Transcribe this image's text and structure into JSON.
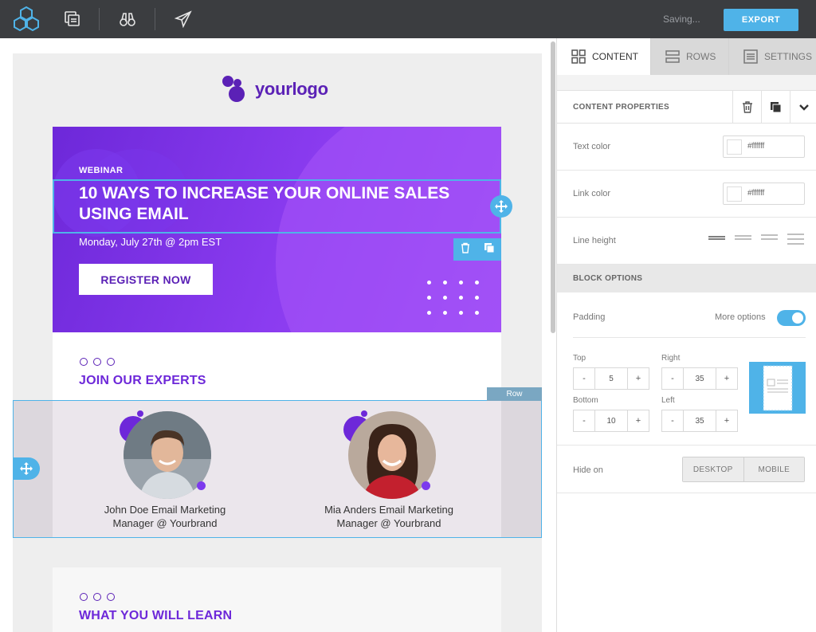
{
  "topbar": {
    "saving_status": "Saving...",
    "export_label": "EXPORT"
  },
  "email": {
    "logo_text": "yourlogo",
    "hero": {
      "eyebrow": "WEBINAR",
      "headline": "10 WAYS TO INCREASE YOUR ONLINE SALES USING EMAIL",
      "date": "Monday, July 27th @ 2pm EST",
      "cta_label": "REGISTER NOW"
    },
    "experts_title": "JOIN OUR EXPERTS",
    "row_tag": "Row",
    "people": [
      {
        "name_line1": "John Doe Email Marketing",
        "name_line2": "Manager @ Yourbrand"
      },
      {
        "name_line1": "Mia Anders Email Marketing",
        "name_line2": "Manager @ Yourbrand"
      }
    ],
    "learn_title": "WHAT YOU WILL LEARN"
  },
  "panel": {
    "tabs": [
      {
        "label": "CONTENT",
        "icon": "grid-icon",
        "active": true
      },
      {
        "label": "ROWS",
        "icon": "rows-icon",
        "active": false
      },
      {
        "label": "SETTINGS",
        "icon": "settings-list-icon",
        "active": false
      }
    ],
    "content_properties_title": "CONTENT PROPERTIES",
    "text_color": {
      "label": "Text color",
      "value": "#ffffff"
    },
    "link_color": {
      "label": "Link color",
      "value": "#ffffff"
    },
    "line_height_label": "Line height",
    "block_options_title": "BLOCK OPTIONS",
    "padding_label": "Padding",
    "more_options_label": "More options",
    "more_options_enabled": true,
    "padding": {
      "top": {
        "label": "Top",
        "value": "5"
      },
      "right": {
        "label": "Right",
        "value": "35"
      },
      "bottom": {
        "label": "Bottom",
        "value": "10"
      },
      "left": {
        "label": "Left",
        "value": "35"
      }
    },
    "hide_on_label": "Hide on",
    "hide_on_options": [
      "DESKTOP",
      "MOBILE"
    ]
  },
  "colors": {
    "accent": "#4fb3e8",
    "brand_purple": "#6d28d9",
    "topbar": "#3b3d40"
  }
}
